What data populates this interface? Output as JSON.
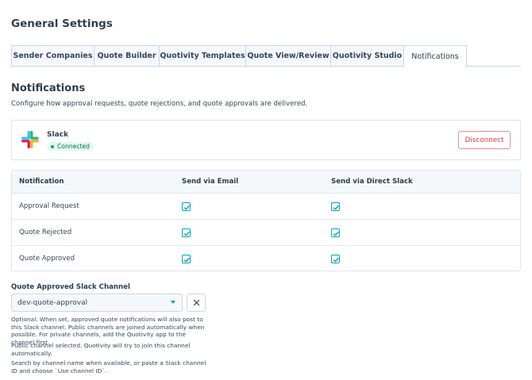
{
  "page_title": "General Settings",
  "tabs": [
    {
      "label": "Sender Companies",
      "active": false
    },
    {
      "label": "Quote Builder",
      "active": false
    },
    {
      "label": "Quotivity Templates",
      "active": false
    },
    {
      "label": "Quote View/Review",
      "active": false
    },
    {
      "label": "Quotivity Studio",
      "active": false
    },
    {
      "label": "Notifications",
      "active": true
    }
  ],
  "section": {
    "title": "Notifications",
    "description": "Configure how approval requests, quote rejections, and quote approvals are delivered."
  },
  "slack": {
    "name": "Slack",
    "status": "Connected",
    "disconnect_label": "Disconnect",
    "icon": "slack-logo"
  },
  "table": {
    "headers": [
      "Notification",
      "Send via Email",
      "Send via Direct Slack"
    ],
    "rows": [
      {
        "name": "Approval Request",
        "email": true,
        "slack": true
      },
      {
        "name": "Quote Rejected",
        "email": true,
        "slack": true
      },
      {
        "name": "Quote Approved",
        "email": true,
        "slack": true
      }
    ]
  },
  "channel": {
    "label": "Quote Approved Slack Channel",
    "value": "dev-quote-approval",
    "help": [
      "Optional. When set, approved quote notifications will also post to this Slack channel. Public channels are joined automatically when possible. For private channels, add the Quotivity app to the channel first.",
      "Public channel selected. Quotivity will try to join this channel automatically.",
      "Search by channel name when available, or paste a Slack channel ID and choose `Use channel ID`."
    ]
  },
  "colors": {
    "accent": "#00a4bd",
    "danger": "#d9383f",
    "success": "#00a86b"
  }
}
